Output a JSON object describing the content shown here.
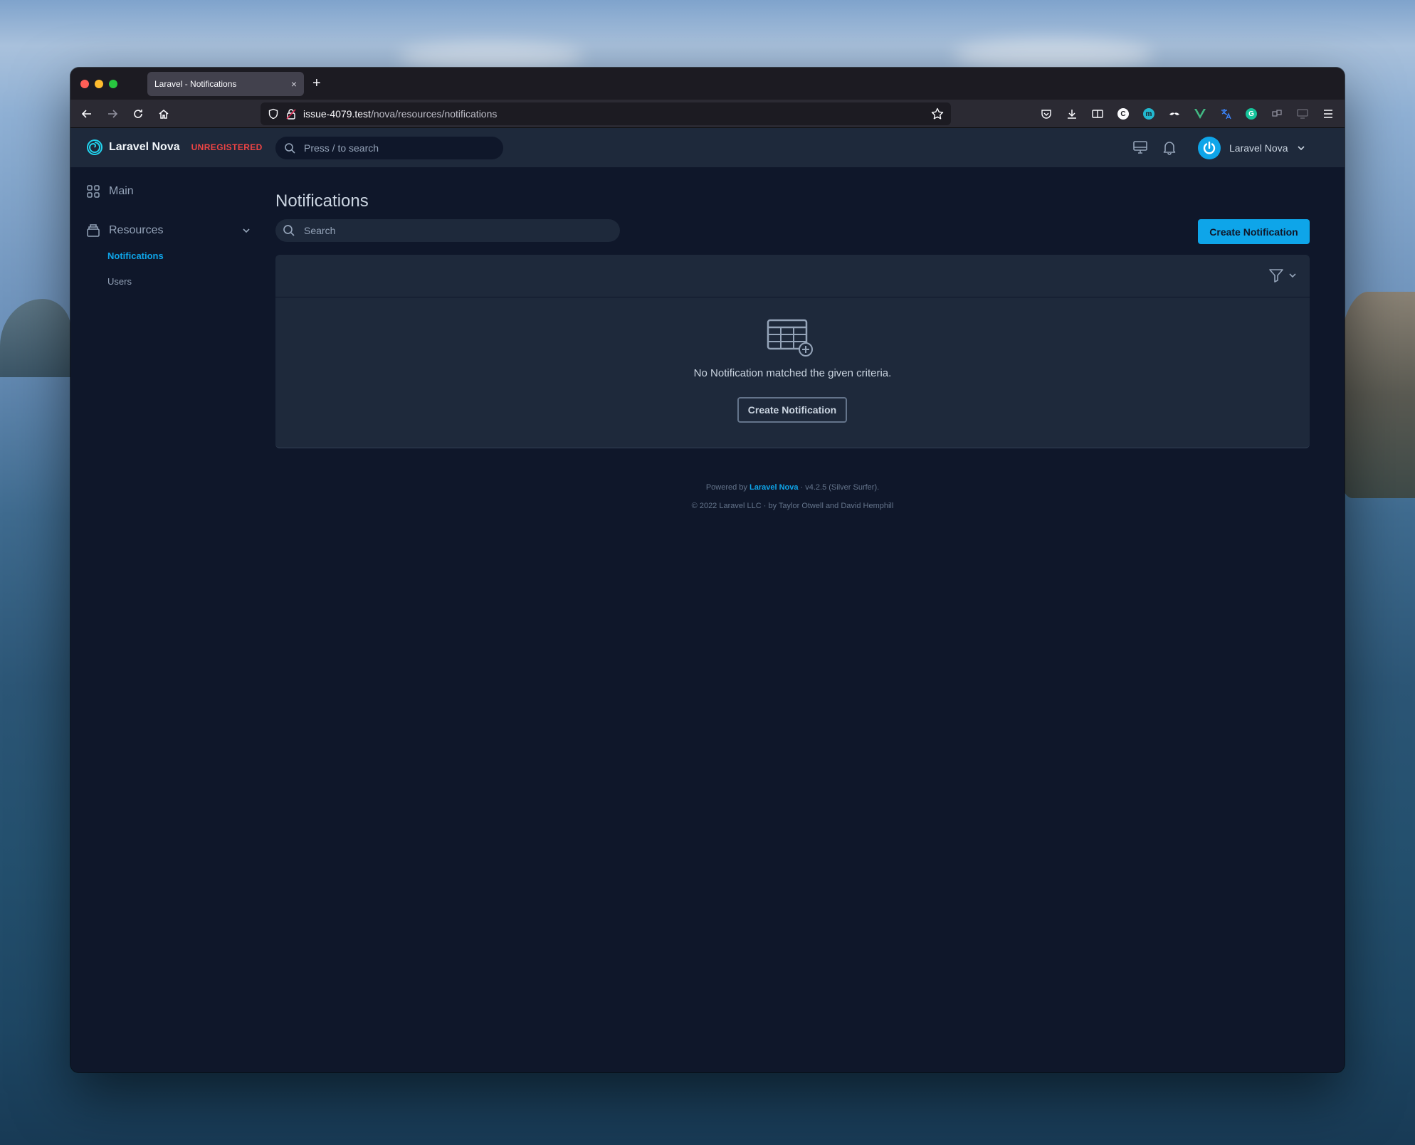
{
  "browser": {
    "tab_title": "Laravel - Notifications",
    "tab_close": "×",
    "new_tab": "+",
    "url_host": "issue-4079.test",
    "url_path": "/nova/resources/notifications"
  },
  "header": {
    "brand": "Laravel Nova",
    "license_badge": "UNREGISTERED",
    "search_placeholder": "Press / to search",
    "user_name": "Laravel Nova"
  },
  "sidebar": {
    "main_label": "Main",
    "resources_label": "Resources",
    "items": [
      {
        "label": "Notifications",
        "active": true
      },
      {
        "label": "Users",
        "active": false
      }
    ]
  },
  "main": {
    "title": "Notifications",
    "search_placeholder": "Search",
    "create_button": "Create Notification",
    "empty_message": "No Notification matched the given criteria.",
    "empty_create_button": "Create Notification"
  },
  "footer": {
    "powered_prefix": "Powered by",
    "powered_link": "Laravel Nova",
    "powered_suffix": "· v4.2.5 (Silver Surfer).",
    "copyright": "© 2022 Laravel LLC · by Taylor Otwell and David Hemphill"
  },
  "colors": {
    "accent": "#0ea5e9",
    "background": "#0f172a",
    "panel": "#1e293b",
    "danger": "#ef4444"
  }
}
